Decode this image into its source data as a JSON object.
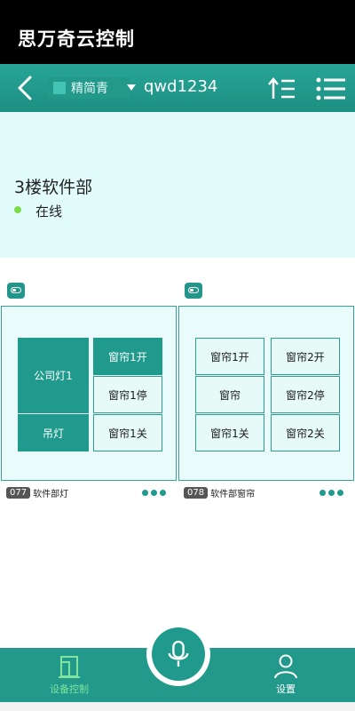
{
  "app": {
    "title": "思万奇云控制"
  },
  "toolbar": {
    "house_name": "精简青",
    "account": "qwd1234"
  },
  "room": {
    "name": "3楼软件部",
    "status": "在线",
    "status_color": "#7ddb4a"
  },
  "colors": {
    "accent": "#1f9a8c",
    "panel_bg": "#e1fcfa"
  },
  "cards": [
    {
      "number": "077",
      "label": "软件部灯",
      "buttons": {
        "company_light": "公司灯1",
        "pendant_light": "吊灯",
        "curtain1_open": "窗帘1开",
        "curtain1_stop": "窗帘1停",
        "curtain1_close": "窗帘1关"
      }
    },
    {
      "number": "078",
      "label": "软件部窗帘",
      "buttons": {
        "curtain1_open": "窗帘1开",
        "curtain": "窗帘",
        "curtain1_close": "窗帘1关",
        "curtain2_open": "窗帘2开",
        "curtain2_stop": "窗帘2停",
        "curtain2_close": "窗帘2关"
      }
    }
  ],
  "bottom_nav": {
    "device_control": "设备控制",
    "settings": "设置"
  }
}
